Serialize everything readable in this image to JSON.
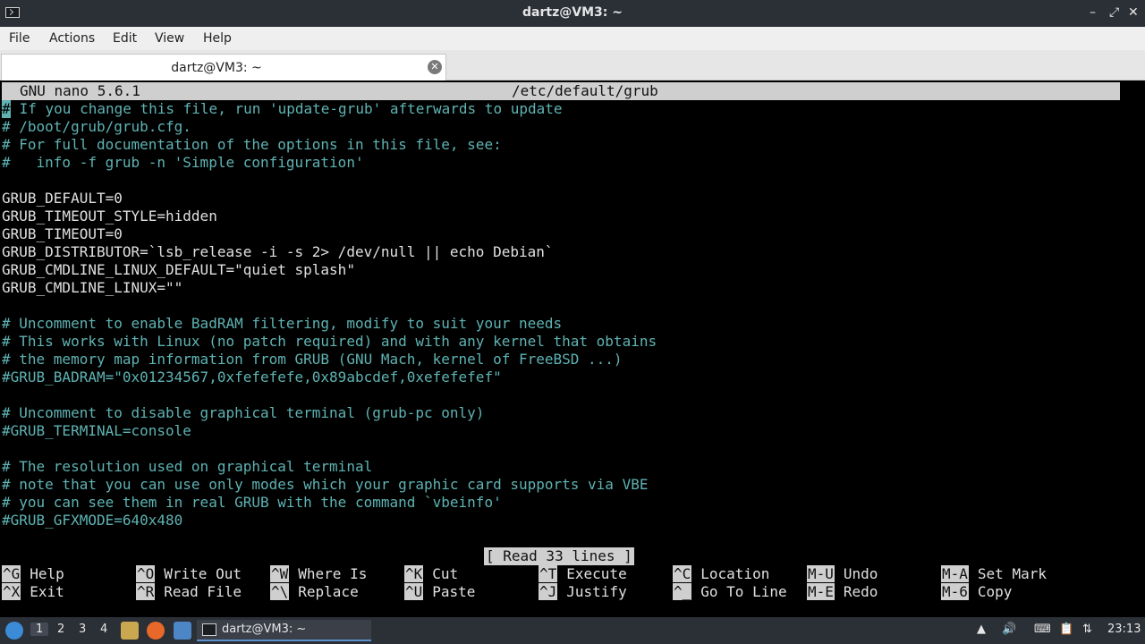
{
  "window": {
    "title": "dartz@VM3: ~",
    "controls": {
      "minimize": "–",
      "restore": "⤢",
      "close": "✕"
    }
  },
  "menubar": {
    "items": [
      "File",
      "Actions",
      "Edit",
      "View",
      "Help"
    ]
  },
  "tab": {
    "label": "dartz@VM3: ~",
    "close": "✕"
  },
  "nano": {
    "version": "GNU nano 5.6.1",
    "filename": "/etc/default/grub",
    "status": "[ Read 33 lines ]",
    "lines": [
      {
        "text": " If you change this file, run 'update-grub' afterwards to update",
        "kind": "comment-first"
      },
      {
        "text": "# /boot/grub/grub.cfg.",
        "kind": "comment"
      },
      {
        "text": "# For full documentation of the options in this file, see:",
        "kind": "comment"
      },
      {
        "text": "#   info -f grub -n 'Simple configuration'",
        "kind": "comment"
      },
      {
        "text": "",
        "kind": "normal"
      },
      {
        "text": "GRUB_DEFAULT=0",
        "kind": "normal"
      },
      {
        "text": "GRUB_TIMEOUT_STYLE=hidden",
        "kind": "normal"
      },
      {
        "text": "GRUB_TIMEOUT=0",
        "kind": "normal"
      },
      {
        "text": "GRUB_DISTRIBUTOR=`lsb_release -i -s 2> /dev/null || echo Debian`",
        "kind": "normal"
      },
      {
        "text": "GRUB_CMDLINE_LINUX_DEFAULT=\"quiet splash\"",
        "kind": "normal"
      },
      {
        "text": "GRUB_CMDLINE_LINUX=\"\"",
        "kind": "normal"
      },
      {
        "text": "",
        "kind": "normal"
      },
      {
        "text": "# Uncomment to enable BadRAM filtering, modify to suit your needs",
        "kind": "comment"
      },
      {
        "text": "# This works with Linux (no patch required) and with any kernel that obtains",
        "kind": "comment"
      },
      {
        "text": "# the memory map information from GRUB (GNU Mach, kernel of FreeBSD ...)",
        "kind": "comment"
      },
      {
        "text": "#GRUB_BADRAM=\"0x01234567,0xfefefefe,0x89abcdef,0xefefefef\"",
        "kind": "comment"
      },
      {
        "text": "",
        "kind": "normal"
      },
      {
        "text": "# Uncomment to disable graphical terminal (grub-pc only)",
        "kind": "comment"
      },
      {
        "text": "#GRUB_TERMINAL=console",
        "kind": "comment"
      },
      {
        "text": "",
        "kind": "normal"
      },
      {
        "text": "# The resolution used on graphical terminal",
        "kind": "comment"
      },
      {
        "text": "# note that you can use only modes which your graphic card supports via VBE",
        "kind": "comment"
      },
      {
        "text": "# you can see them in real GRUB with the command `vbeinfo'",
        "kind": "comment"
      },
      {
        "text": "#GRUB_GFXMODE=640x480",
        "kind": "comment"
      }
    ],
    "cursor_char": "#",
    "shortcuts_row1": [
      {
        "key": "^G",
        "label": "Help"
      },
      {
        "key": "^O",
        "label": "Write Out"
      },
      {
        "key": "^W",
        "label": "Where Is"
      },
      {
        "key": "^K",
        "label": "Cut"
      },
      {
        "key": "^T",
        "label": "Execute"
      },
      {
        "key": "^C",
        "label": "Location"
      },
      {
        "key": "M-U",
        "label": "Undo"
      },
      {
        "key": "M-A",
        "label": "Set Mark"
      }
    ],
    "shortcuts_row2": [
      {
        "key": "^X",
        "label": "Exit"
      },
      {
        "key": "^R",
        "label": "Read File"
      },
      {
        "key": "^\\",
        "label": "Replace"
      },
      {
        "key": "^U",
        "label": "Paste"
      },
      {
        "key": "^J",
        "label": "Justify"
      },
      {
        "key": "^_",
        "label": "Go To Line"
      },
      {
        "key": "M-E",
        "label": "Redo"
      },
      {
        "key": "M-6",
        "label": "Copy"
      }
    ]
  },
  "taskbar": {
    "workspaces": [
      "1",
      "2",
      "3",
      "4"
    ],
    "active_task": "dartz@VM3: ~",
    "clock": "23:13",
    "tray_icons": [
      "arrow-up-icon",
      "volume-icon",
      "keyboard-icon",
      "clipboard-icon",
      "network-icon"
    ]
  }
}
